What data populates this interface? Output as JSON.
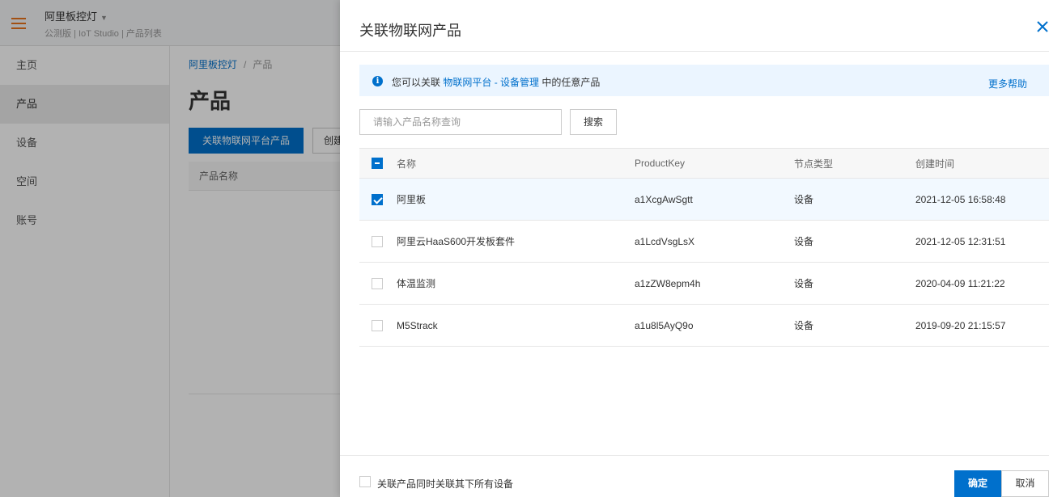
{
  "header": {
    "app_name": "阿里板控灯",
    "app_subtitle": "公测版 | IoT Studio | 产品列表"
  },
  "sidebar": {
    "items": [
      {
        "label": "主页",
        "active": false
      },
      {
        "label": "产品",
        "active": true
      },
      {
        "label": "设备",
        "active": false
      },
      {
        "label": "空间",
        "active": false
      },
      {
        "label": "账号",
        "active": false
      }
    ]
  },
  "main": {
    "breadcrumb_root": "阿里板控灯",
    "breadcrumb_sep": "/",
    "breadcrumb_current": "产品",
    "title": "产品",
    "primary_button": "关联物联网平台产品",
    "secondary_button": "创建",
    "table_header": "产品名称"
  },
  "drawer": {
    "title": "关联物联网产品",
    "notice": {
      "prefix": "您可以关联",
      "link": "物联网平台 - 设备管理",
      "suffix": "中的任意产品",
      "more_help": "更多帮助"
    },
    "search": {
      "placeholder": "请输入产品名称查询",
      "button": "搜索"
    },
    "table": {
      "columns": [
        "名称",
        "ProductKey",
        "节点类型",
        "创建时间"
      ],
      "rows": [
        {
          "name": "阿里板",
          "product_key": "a1XcgAwSgtt",
          "node_type": "设备",
          "created": "2021-12-05 16:58:48",
          "checked": true
        },
        {
          "name": "阿里云HaaS600开发板套件",
          "product_key": "a1LcdVsgLsX",
          "node_type": "设备",
          "created": "2021-12-05 12:31:51",
          "checked": false
        },
        {
          "name": "体温监测",
          "product_key": "a1zZW8epm4h",
          "node_type": "设备",
          "created": "2020-04-09 11:21:22",
          "checked": false
        },
        {
          "name": "M5Strack",
          "product_key": "a1u8l5AyQ9o",
          "node_type": "设备",
          "created": "2019-09-20 21:15:57",
          "checked": false
        }
      ]
    },
    "footer": {
      "checkbox_label": "关联产品同时关联其下所有设备",
      "checkbox_checked": false,
      "ok": "确定",
      "cancel": "取消"
    }
  },
  "colors": {
    "accent": "#0070cc",
    "menu_icon": "#e8731b",
    "notice_bg": "#ebf5ff"
  }
}
